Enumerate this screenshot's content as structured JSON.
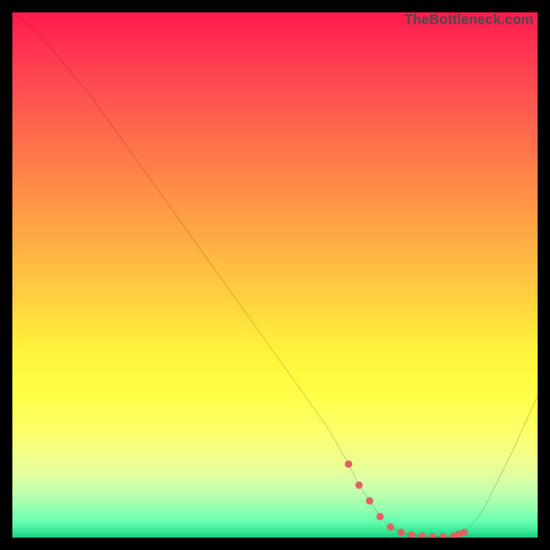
{
  "watermark": "TheBottleneck.com",
  "chart_data": {
    "type": "line",
    "title": "",
    "xlabel": "",
    "ylabel": "",
    "xlim": [
      0,
      100
    ],
    "ylim": [
      0,
      100
    ],
    "x": [
      0,
      5,
      10,
      15,
      20,
      25,
      30,
      35,
      40,
      45,
      50,
      55,
      60,
      64,
      66,
      68,
      70,
      72,
      74,
      76,
      78,
      80,
      82,
      84,
      86,
      88,
      90,
      92,
      95,
      100
    ],
    "values": [
      100,
      96,
      90,
      84,
      77,
      70,
      63,
      56,
      49,
      42,
      35,
      28,
      21,
      14,
      10,
      7,
      4,
      2,
      1,
      0.5,
      0.3,
      0.2,
      0.2,
      0.3,
      1,
      3,
      6,
      10,
      16,
      27
    ],
    "dotted_segment_x": [
      64,
      66,
      68,
      70,
      72,
      74,
      76,
      78,
      80,
      82,
      84,
      85,
      86
    ],
    "dot_color": "#e06262",
    "line_color": "#000000",
    "legend": null,
    "grid": false
  }
}
